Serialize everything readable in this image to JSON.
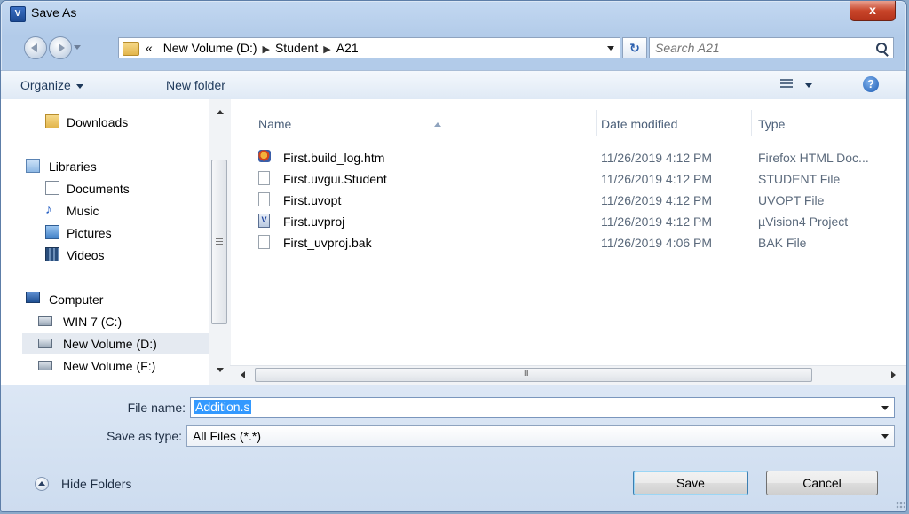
{
  "window": {
    "title": "Save As",
    "close_label": "x"
  },
  "nav": {
    "address_segments": [
      "«",
      "New Volume (D:)",
      "Student",
      "A21"
    ],
    "search_placeholder": "Search A21"
  },
  "toolbar": {
    "organize_label": "Organize",
    "new_folder_label": "New folder",
    "help_label": "?"
  },
  "sidebar": {
    "items": [
      {
        "label": "Downloads",
        "icon": "downloads-folder-icon"
      },
      {
        "label": "Libraries",
        "icon": "libraries-icon"
      },
      {
        "label": "Documents",
        "icon": "documents-icon"
      },
      {
        "label": "Music",
        "icon": "music-icon"
      },
      {
        "label": "Pictures",
        "icon": "pictures-icon"
      },
      {
        "label": "Videos",
        "icon": "videos-icon"
      },
      {
        "label": "Computer",
        "icon": "computer-icon"
      },
      {
        "label": "WIN 7 (C:)",
        "icon": "drive-icon"
      },
      {
        "label": "New Volume (D:)",
        "icon": "drive-icon",
        "selected": true
      },
      {
        "label": "New Volume (F:)",
        "icon": "drive-icon"
      }
    ]
  },
  "files": {
    "columns": {
      "name": "Name",
      "date": "Date modified",
      "type": "Type"
    },
    "rows": [
      {
        "name": "First.build_log.htm",
        "date": "11/26/2019 4:12 PM",
        "type": "Firefox HTML Doc...",
        "icon": "firefox-html-icon"
      },
      {
        "name": "First.uvgui.Student",
        "date": "11/26/2019 4:12 PM",
        "type": "STUDENT File",
        "icon": "file-icon"
      },
      {
        "name": "First.uvopt",
        "date": "11/26/2019 4:12 PM",
        "type": "UVOPT File",
        "icon": "file-icon"
      },
      {
        "name": "First.uvproj",
        "date": "11/26/2019 4:12 PM",
        "type": "µVision4 Project",
        "icon": "uvision-project-icon"
      },
      {
        "name": "First_uvproj.bak",
        "date": "11/26/2019 4:06 PM",
        "type": "BAK File",
        "icon": "file-icon"
      }
    ],
    "hscroll_glyph": "III"
  },
  "form": {
    "file_name_label": "File name:",
    "file_name_value": "Addition.s",
    "save_type_label": "Save as type:",
    "save_type_value": "All Files (*.*)",
    "hide_folders_label": "Hide Folders",
    "save_label": "Save",
    "cancel_label": "Cancel"
  },
  "colors": {
    "selection": "#3399ff",
    "frame": "#b2cbe9",
    "close": "#c8452a"
  }
}
